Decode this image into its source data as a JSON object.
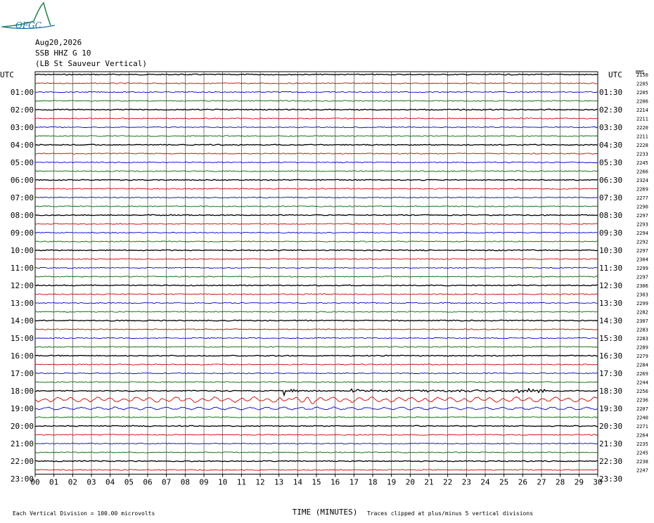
{
  "header": {
    "date": "Aug20,2026",
    "station": "SSB HHZ G 10",
    "location": "(LB St Sauveur Vertical)"
  },
  "logo": {
    "text": "OFGC"
  },
  "chart_data": {
    "type": "line",
    "title": "",
    "xlabel": "TIME (MINUTES)",
    "ylabel_left": "UTC",
    "ylabel_right": "UTC",
    "rms_label": "RMS",
    "x_ticks": [
      "00",
      "01",
      "02",
      "03",
      "04",
      "05",
      "06",
      "07",
      "08",
      "09",
      "10",
      "11",
      "12",
      "13",
      "14",
      "15",
      "16",
      "17",
      "18",
      "19",
      "20",
      "21",
      "22",
      "23",
      "24",
      "25",
      "26",
      "27",
      "28",
      "29",
      "30"
    ],
    "xlim": [
      0,
      30
    ],
    "left_hour_labels": [
      "01:00",
      "02:00",
      "03:00",
      "04:00",
      "05:00",
      "06:00",
      "07:00",
      "08:00",
      "09:00",
      "10:00",
      "11:00",
      "12:00",
      "13:00",
      "14:00",
      "15:00",
      "16:00",
      "17:00",
      "18:00",
      "19:00",
      "20:00",
      "21:00",
      "22:00",
      "23:00"
    ],
    "right_hour_labels": [
      "01:30",
      "02:30",
      "03:30",
      "04:30",
      "05:30",
      "06:30",
      "07:30",
      "08:30",
      "09:30",
      "10:30",
      "11:30",
      "12:30",
      "13:30",
      "14:30",
      "15:30",
      "16:30",
      "17:30",
      "18:30",
      "19:30",
      "20:30",
      "21:30",
      "22:30",
      "23:30"
    ],
    "trace_colors": [
      "#000000",
      "#cc0000",
      "#0000cc",
      "#006400"
    ],
    "trace_values": [
      2150,
      2205,
      2205,
      2206,
      2214,
      2211,
      2220,
      2211,
      2228,
      2233,
      2245,
      2266,
      2324,
      2269,
      2277,
      2290,
      2297,
      2293,
      2294,
      2292,
      2297,
      2304,
      2299,
      2297,
      2306,
      2303,
      2299,
      2282,
      2307,
      2283,
      2283,
      2289,
      2279,
      2284,
      2269,
      2244,
      2256,
      2236,
      2207,
      2240,
      2271,
      2264,
      2235,
      2245,
      2238,
      2247
    ],
    "footer_left": "Each Vertical Division =  100.00 microvolts",
    "footer_right": "Traces clipped at plus/minus 5 vertical divisions"
  },
  "colors": {
    "grid": "#000000",
    "background": "#ffffff",
    "logo": "#1a6aa8"
  }
}
